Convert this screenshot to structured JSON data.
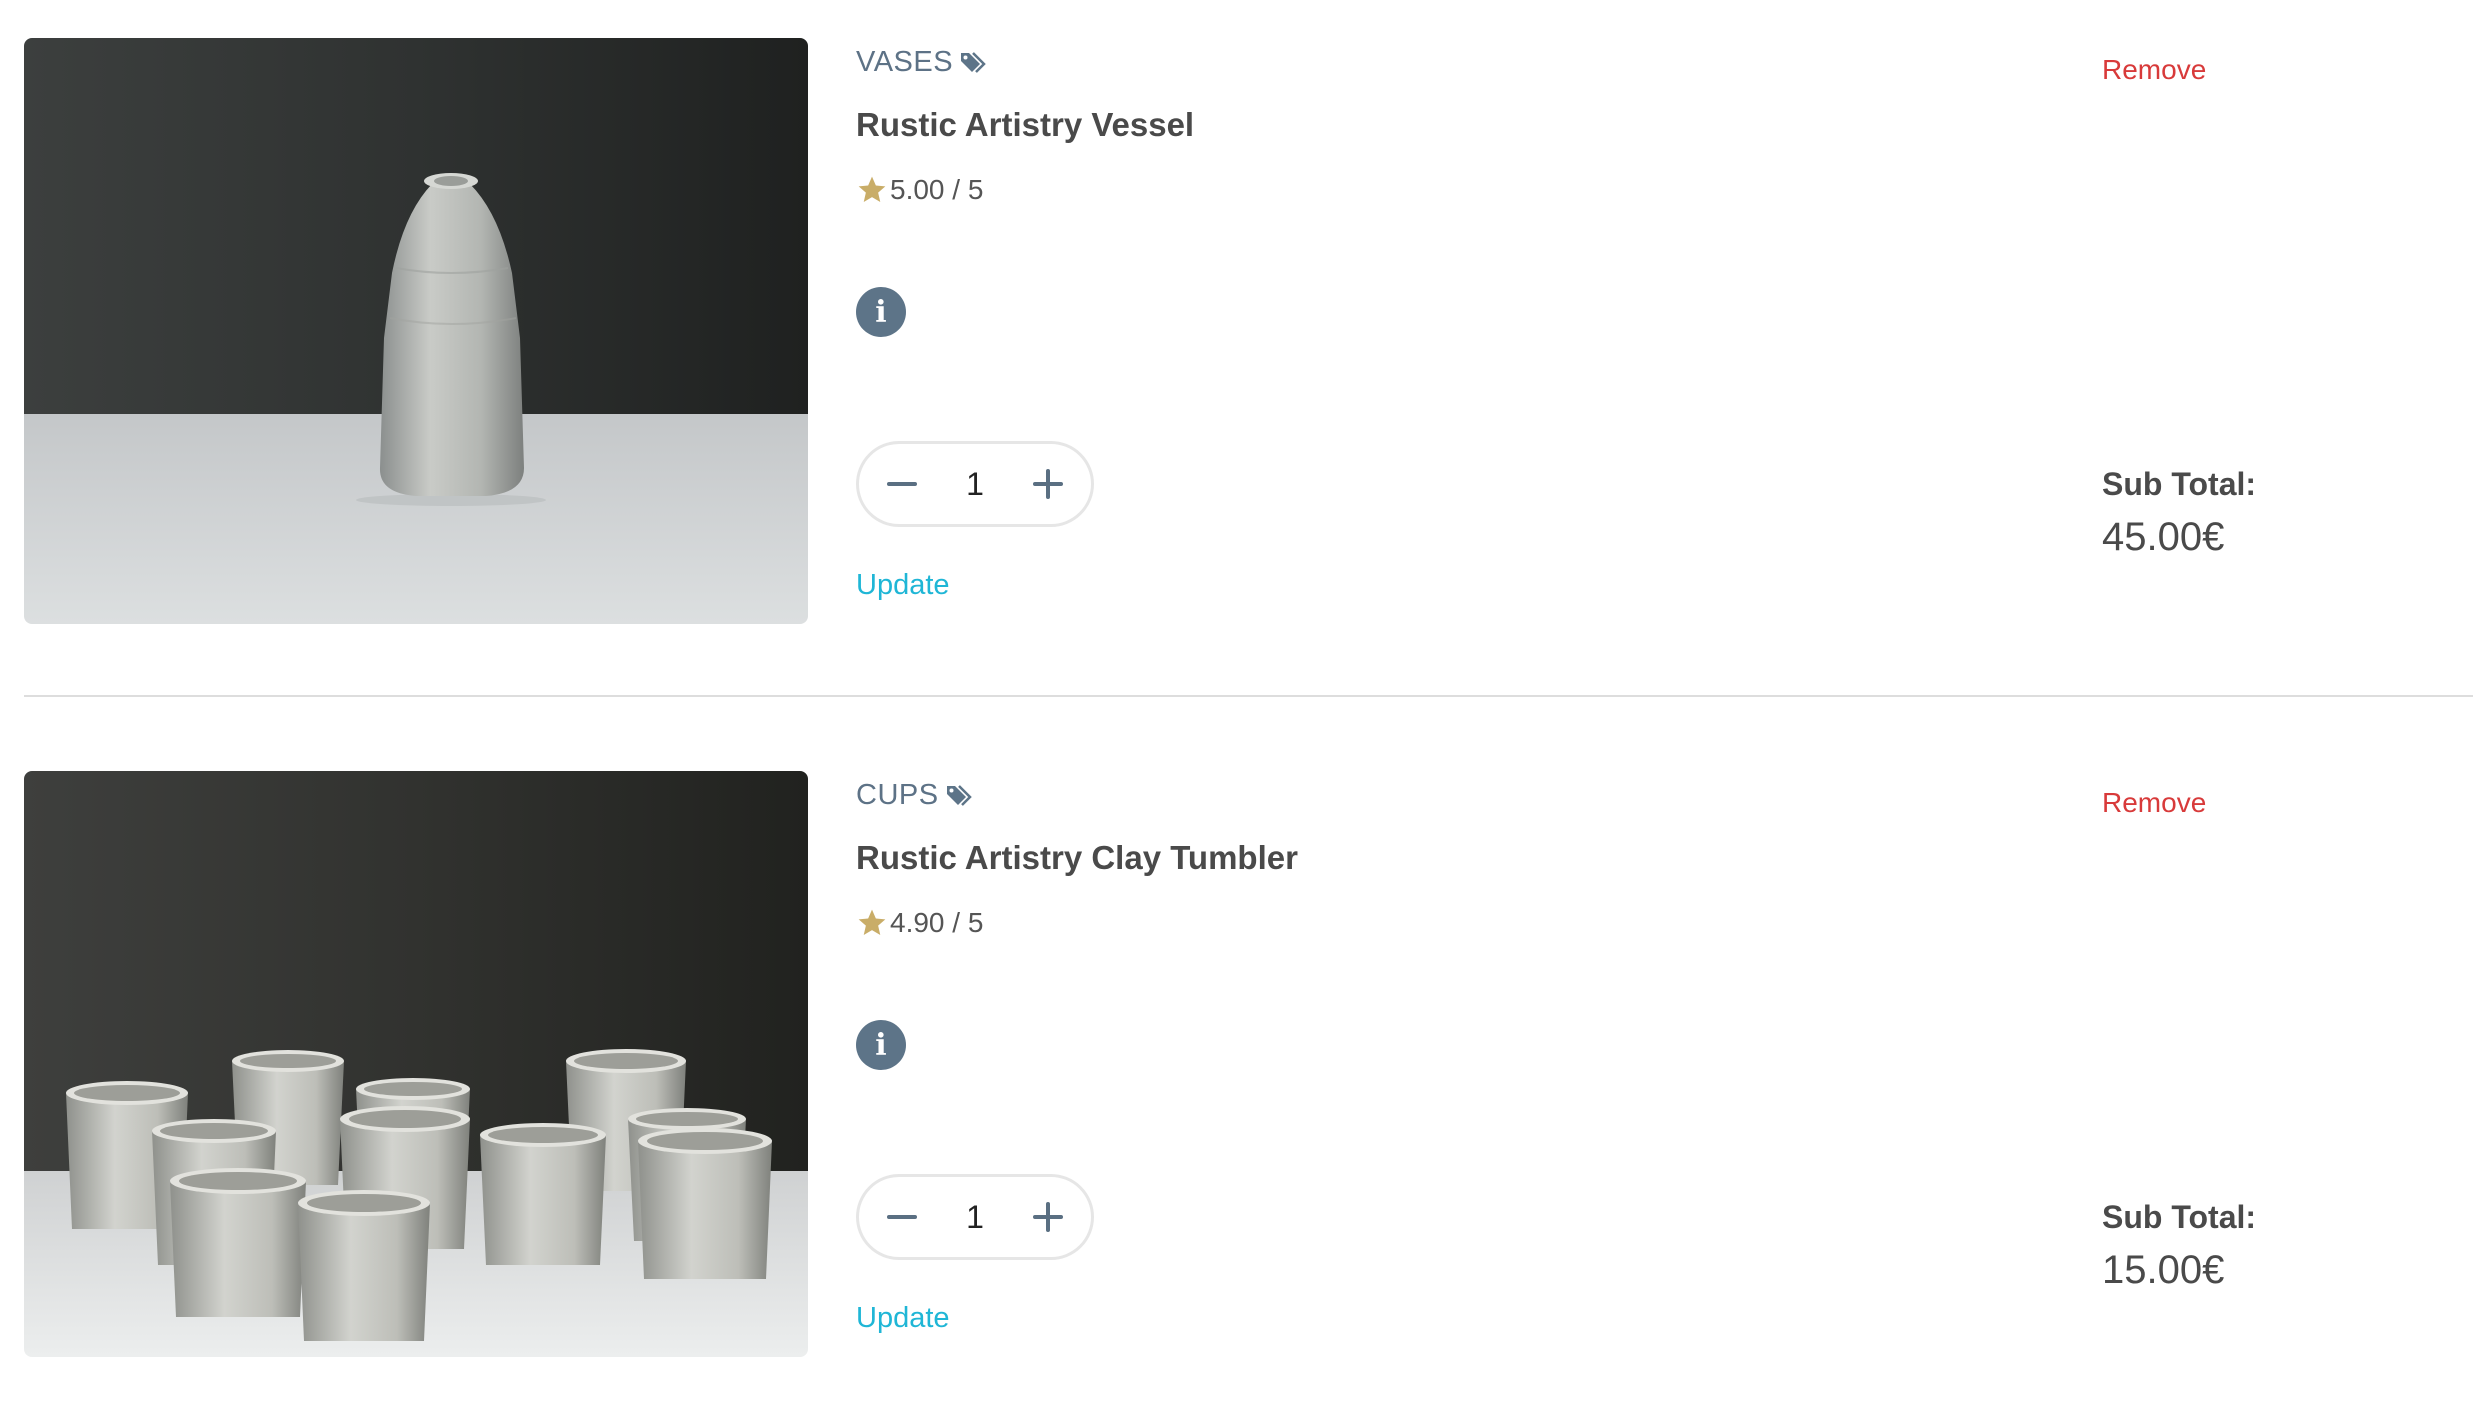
{
  "cart": {
    "items": [
      {
        "category": "VASES",
        "name": "Rustic Artistry Vessel",
        "rating": "5.00 / 5",
        "quantity": "1",
        "update_label": "Update",
        "remove_label": "Remove",
        "subtotal_label": "Sub Total:",
        "subtotal_value": "45.00€"
      },
      {
        "category": "CUPS",
        "name": "Rustic Artistry Clay Tumbler",
        "rating": "4.90 / 5",
        "quantity": "1",
        "update_label": "Update",
        "remove_label": "Remove",
        "subtotal_label": "Sub Total:",
        "subtotal_value": "15.00€"
      }
    ]
  },
  "icons": {
    "category": "tags-icon",
    "rating": "star-icon",
    "info": "info-icon",
    "decrement": "minus-icon",
    "increment": "plus-icon"
  },
  "colors": {
    "remove": "#d83a3a",
    "update": "#1fb6d6",
    "star": "#c9ad68",
    "icon": "#5d7488"
  }
}
